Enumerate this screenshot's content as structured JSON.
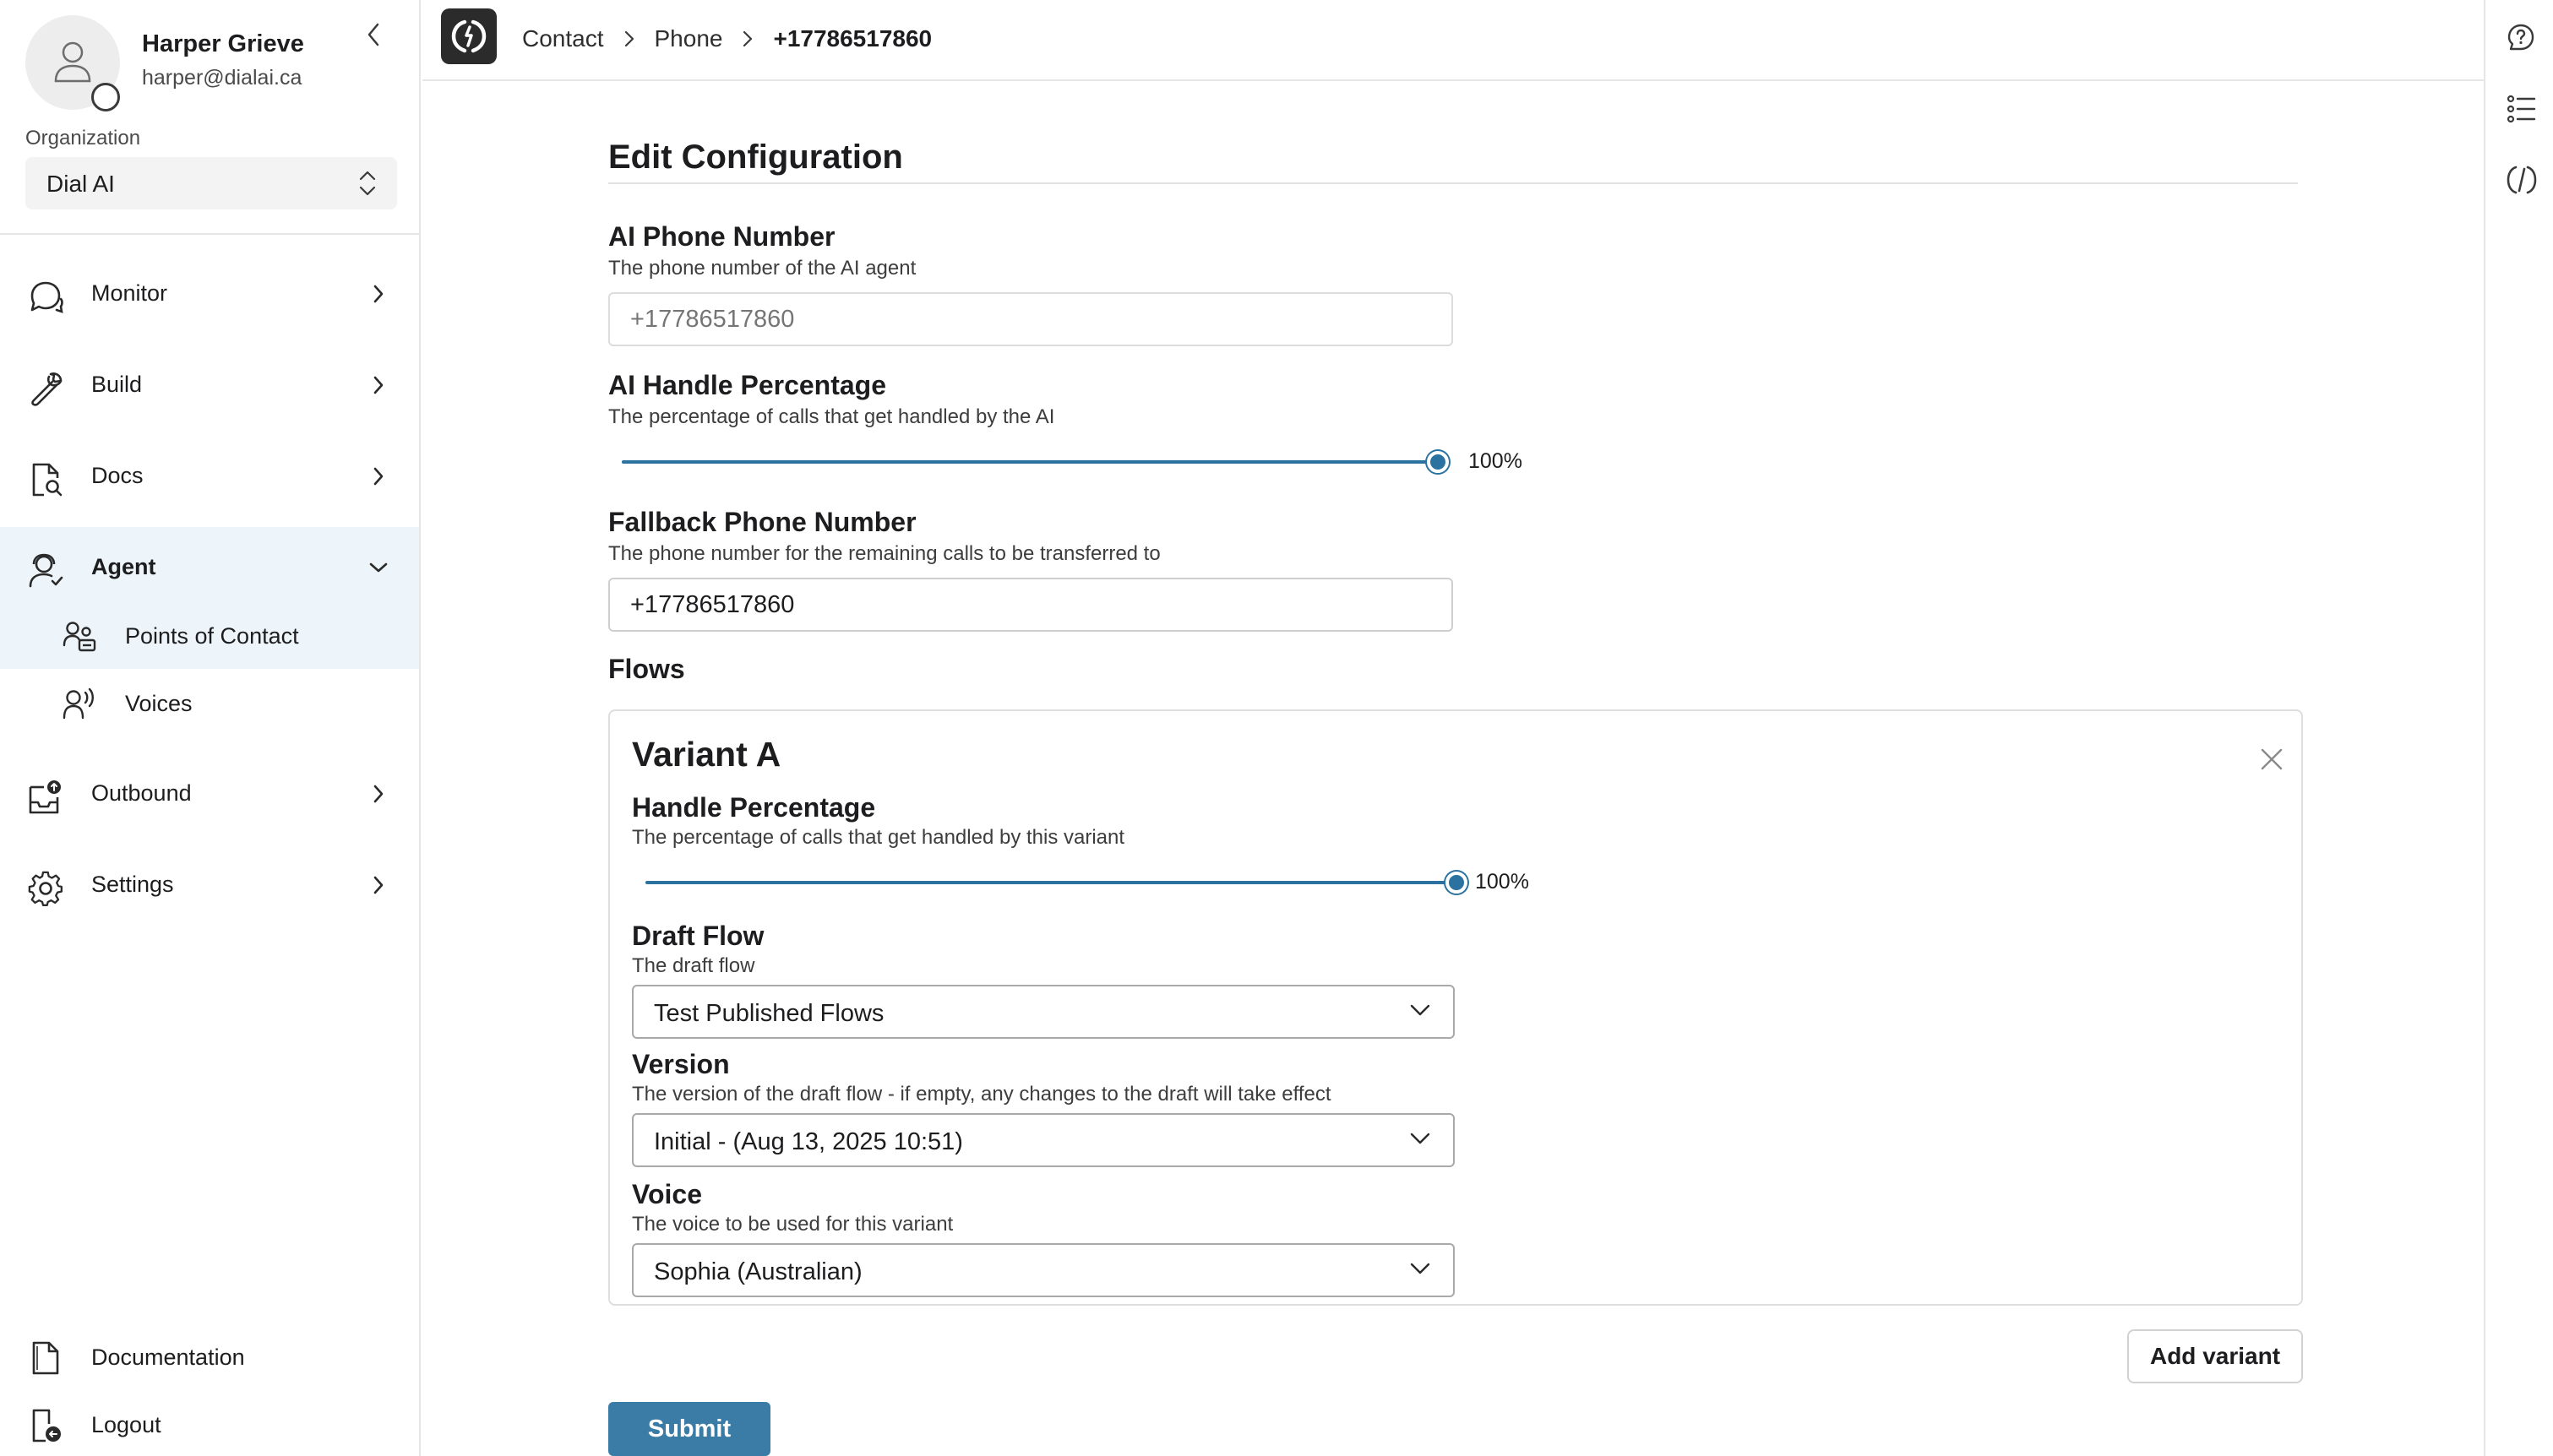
{
  "user": {
    "name": "Harper Grieve",
    "email": "harper@dialai.ca"
  },
  "organization": {
    "label": "Organization",
    "value": "Dial AI"
  },
  "sidebar": {
    "items": [
      {
        "label": "Monitor",
        "icon": "chat-bubble-icon",
        "expanded": false
      },
      {
        "label": "Build",
        "icon": "wrench-icon",
        "expanded": false
      },
      {
        "label": "Docs",
        "icon": "document-search-icon",
        "expanded": false
      },
      {
        "label": "Agent",
        "icon": "agent-icon",
        "expanded": true,
        "active": true
      },
      {
        "label": "Outbound",
        "icon": "outbound-inbox-icon",
        "expanded": false
      },
      {
        "label": "Settings",
        "icon": "gear-icon",
        "expanded": false
      }
    ],
    "agent_subitems": [
      {
        "label": "Points of Contact",
        "icon": "contacts-icon",
        "active": true
      },
      {
        "label": "Voices",
        "icon": "voice-icon",
        "active": false
      }
    ],
    "footer": [
      {
        "label": "Documentation",
        "icon": "documentation-icon"
      },
      {
        "label": "Logout",
        "icon": "logout-icon"
      }
    ]
  },
  "breadcrumb": [
    "Contact",
    "Phone",
    "+17786517860"
  ],
  "right_rail": [
    "help-icon",
    "list-icon",
    "code-icon"
  ],
  "form": {
    "title": "Edit Configuration",
    "ai_phone": {
      "label": "AI Phone Number",
      "help": "The phone number of the AI agent",
      "placeholder": "+17786517860"
    },
    "ai_handle": {
      "label": "AI Handle Percentage",
      "help": "The percentage of calls that get handled by the AI",
      "value": 100,
      "value_text": "100%"
    },
    "fallback": {
      "label": "Fallback Phone Number",
      "help": "The phone number for the remaining calls to be transferred to",
      "value": "+17786517860"
    },
    "flows_label": "Flows",
    "variant": {
      "title": "Variant A",
      "handle": {
        "label": "Handle Percentage",
        "help": "The percentage of calls that get handled by this variant",
        "value": 100,
        "value_text": "100%"
      },
      "draft_flow": {
        "label": "Draft Flow",
        "help": "The draft flow",
        "value": "Test Published Flows"
      },
      "version": {
        "label": "Version",
        "help": "The version of the draft flow - if empty, any changes to the draft will take effect",
        "value": "Initial - (Aug 13, 2025 10:51)"
      },
      "voice": {
        "label": "Voice",
        "help": "The voice to be used for this variant",
        "value": "Sophia (Australian)"
      }
    },
    "add_variant_label": "Add variant",
    "submit_label": "Submit"
  },
  "colors": {
    "accent": "#2b72a0",
    "submit": "#3a7ca5",
    "active_nav_bg": "#eef5fa"
  }
}
